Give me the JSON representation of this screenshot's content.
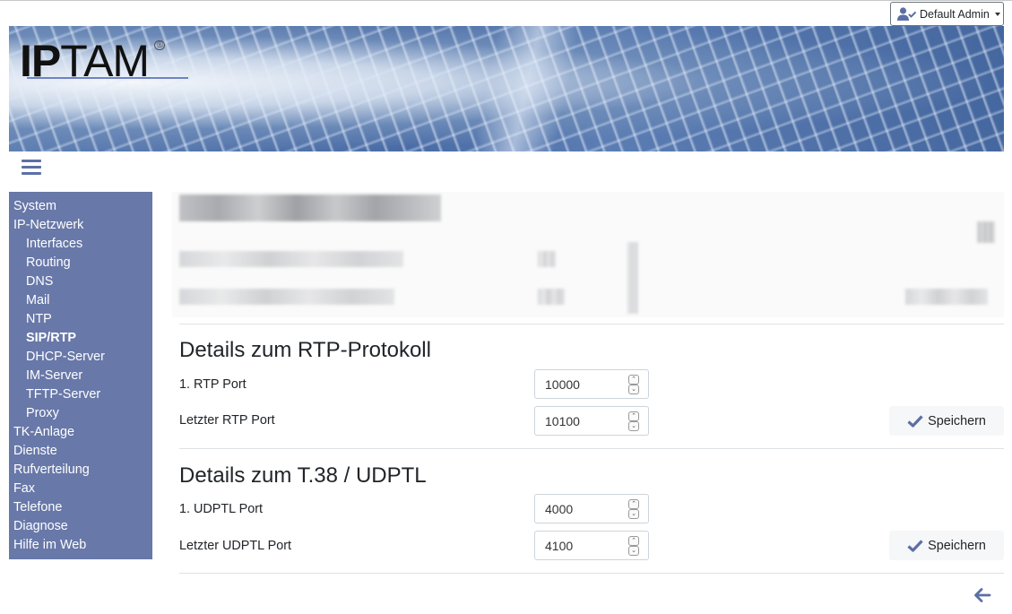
{
  "header": {
    "user_menu_label": "Default Admin",
    "logo_text_bold": "IP",
    "logo_text_thin": "TAM",
    "logo_reg_mark": "®"
  },
  "colors": {
    "sidebar_bg": "#6878a8",
    "accent": "#5c6fa5"
  },
  "sidebar": {
    "items": [
      {
        "label": "System",
        "level": 0,
        "active": false
      },
      {
        "label": "IP-Netzwerk",
        "level": 0,
        "active": false
      },
      {
        "label": "Interfaces",
        "level": 1,
        "active": false
      },
      {
        "label": "Routing",
        "level": 1,
        "active": false
      },
      {
        "label": "DNS",
        "level": 1,
        "active": false
      },
      {
        "label": "Mail",
        "level": 1,
        "active": false
      },
      {
        "label": "NTP",
        "level": 1,
        "active": false
      },
      {
        "label": "SIP/RTP",
        "level": 1,
        "active": true
      },
      {
        "label": "DHCP-Server",
        "level": 1,
        "active": false
      },
      {
        "label": "IM-Server",
        "level": 1,
        "active": false
      },
      {
        "label": "TFTP-Server",
        "level": 1,
        "active": false
      },
      {
        "label": "Proxy",
        "level": 1,
        "active": false
      },
      {
        "label": "TK-Anlage",
        "level": 0,
        "active": false
      },
      {
        "label": "Dienste",
        "level": 0,
        "active": false
      },
      {
        "label": "Rufverteilung",
        "level": 0,
        "active": false
      },
      {
        "label": "Fax",
        "level": 0,
        "active": false
      },
      {
        "label": "Telefone",
        "level": 0,
        "active": false
      },
      {
        "label": "Diagnose",
        "level": 0,
        "active": false
      },
      {
        "label": "Hilfe im Web",
        "level": 0,
        "active": false
      }
    ]
  },
  "rtp_section": {
    "title": "Details zum RTP-Protokoll",
    "fields": [
      {
        "label": "1. RTP Port",
        "value": "10000"
      },
      {
        "label": "Letzter RTP Port",
        "value": "10100"
      }
    ],
    "save_label": "Speichern"
  },
  "udptl_section": {
    "title": "Details zum T.38 / UDPTL",
    "fields": [
      {
        "label": "1. UDPTL Port",
        "value": "4000"
      },
      {
        "label": "Letzter UDPTL Port",
        "value": "4100"
      }
    ],
    "save_label": "Speichern"
  },
  "icons": {
    "user": "user-check-icon",
    "menu": "hamburger-icon",
    "save": "checkmark-icon",
    "back": "arrow-left-icon",
    "spin_up": "▲",
    "spin_down": "▼"
  }
}
